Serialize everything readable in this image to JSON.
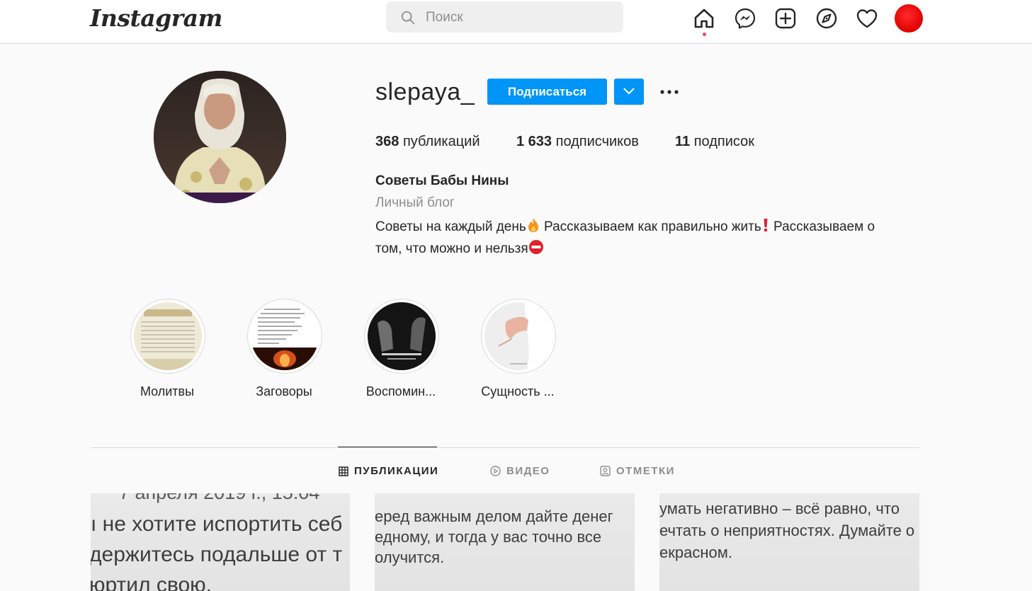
{
  "nav": {
    "logo": "Instagram",
    "search_placeholder": "Поиск",
    "icons": [
      "home-icon",
      "messenger-icon",
      "new-post-icon",
      "explore-icon",
      "activity-heart-icon",
      "profile-avatar"
    ]
  },
  "profile": {
    "username": "slepaya_",
    "follow_label": "Подписаться",
    "stats": [
      {
        "count": "368",
        "label": "публикаций"
      },
      {
        "count": "1 633",
        "label": "подписчиков"
      },
      {
        "count": "11",
        "label": "подписок"
      }
    ],
    "full_name": "Советы Бабы Нины",
    "category": "Личный блог",
    "bio_part1": "Советы на каждый день",
    "bio_part2": " Рассказываем как правильно жить",
    "bio_part3": " Рассказываем о",
    "bio_part4": "том, что можно и нельзя"
  },
  "highlights": [
    {
      "label": "Молитвы"
    },
    {
      "label": "Заговоры"
    },
    {
      "label": "Воспомин..."
    },
    {
      "label": "Сущность ..."
    }
  ],
  "tabs": [
    {
      "label": "ПУБЛИКАЦИИ",
      "active": true
    },
    {
      "label": "ВИДЕО",
      "active": false
    },
    {
      "label": "ОТМЕТКИ",
      "active": false
    }
  ],
  "posts": [
    {
      "lines": [
        "7 апреля 2019 г., 15:04",
        "ı не хотите испортить себ",
        "держитесь подальше от т",
        "юртил свою."
      ]
    },
    {
      "lines": [
        "еред важным делом дайте денег",
        "едному, и тогда у вас точно все",
        "олучится."
      ]
    },
    {
      "lines": [
        "умать негативно – всё равно, что",
        "ечтать о неприятностях. Думайте о",
        "екрасном."
      ]
    }
  ],
  "colors": {
    "accent": "#0095f6",
    "text": "#262626",
    "secondary": "#8e8e8e",
    "background": "#fafafa"
  }
}
